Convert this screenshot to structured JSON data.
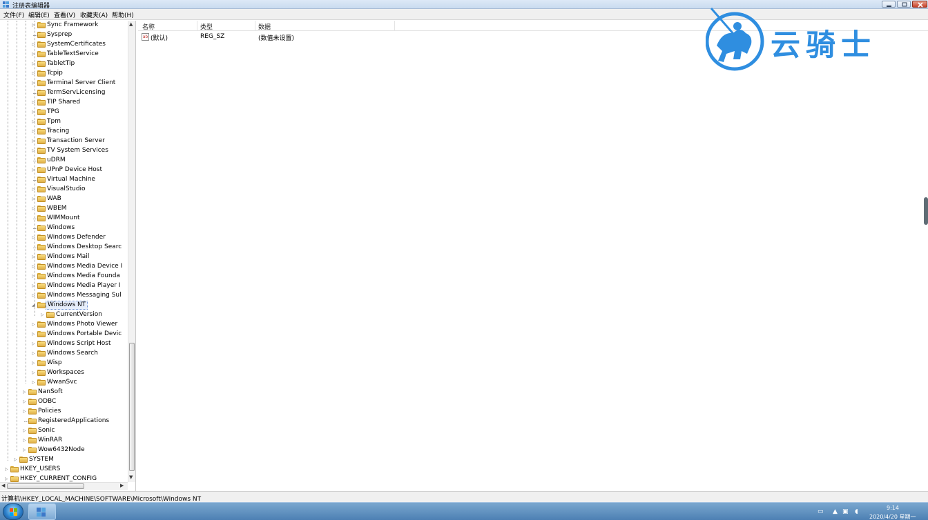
{
  "window": {
    "title": "注册表编辑器"
  },
  "menu": [
    "文件(F)",
    "编辑(E)",
    "查看(V)",
    "收藏夹(A)",
    "帮助(H)"
  ],
  "tree": {
    "items": [
      {
        "label": "Sync Framework",
        "level": 3,
        "expandable": true
      },
      {
        "label": "Sysprep",
        "level": 3,
        "expandable": false
      },
      {
        "label": "SystemCertificates",
        "level": 3,
        "expandable": true
      },
      {
        "label": "TableTextService",
        "level": 3,
        "expandable": true
      },
      {
        "label": "TabletTip",
        "level": 3,
        "expandable": true
      },
      {
        "label": "Tcpip",
        "level": 3,
        "expandable": true
      },
      {
        "label": "Terminal Server Client",
        "level": 3,
        "expandable": true
      },
      {
        "label": "TermServLicensing",
        "level": 3,
        "expandable": false
      },
      {
        "label": "TIP Shared",
        "level": 3,
        "expandable": true
      },
      {
        "label": "TPG",
        "level": 3,
        "expandable": true
      },
      {
        "label": "Tpm",
        "level": 3,
        "expandable": true
      },
      {
        "label": "Tracing",
        "level": 3,
        "expandable": true
      },
      {
        "label": "Transaction Server",
        "level": 3,
        "expandable": true
      },
      {
        "label": "TV System Services",
        "level": 3,
        "expandable": true
      },
      {
        "label": "uDRM",
        "level": 3,
        "expandable": false
      },
      {
        "label": "UPnP Device Host",
        "level": 3,
        "expandable": true
      },
      {
        "label": "Virtual Machine",
        "level": 3,
        "expandable": false
      },
      {
        "label": "VisualStudio",
        "level": 3,
        "expandable": true
      },
      {
        "label": "WAB",
        "level": 3,
        "expandable": true
      },
      {
        "label": "WBEM",
        "level": 3,
        "expandable": true
      },
      {
        "label": "WIMMount",
        "level": 3,
        "expandable": false
      },
      {
        "label": "Windows",
        "level": 3,
        "expandable": false
      },
      {
        "label": "Windows Defender",
        "level": 3,
        "expandable": true
      },
      {
        "label": "Windows Desktop Searc",
        "level": 3,
        "expandable": false
      },
      {
        "label": "Windows Mail",
        "level": 3,
        "expandable": true
      },
      {
        "label": "Windows Media Device I",
        "level": 3,
        "expandable": true
      },
      {
        "label": "Windows Media Founda",
        "level": 3,
        "expandable": true
      },
      {
        "label": "Windows Media Player I",
        "level": 3,
        "expandable": true
      },
      {
        "label": "Windows Messaging Sul",
        "level": 3,
        "expandable": true
      },
      {
        "label": "Windows NT",
        "level": 3,
        "expandable": true,
        "expanded": true,
        "selected": true
      },
      {
        "label": "CurrentVersion",
        "level": 4,
        "expandable": true
      },
      {
        "label": "Windows Photo Viewer",
        "level": 3,
        "expandable": true
      },
      {
        "label": "Windows Portable Devic",
        "level": 3,
        "expandable": true
      },
      {
        "label": "Windows Script Host",
        "level": 3,
        "expandable": true
      },
      {
        "label": "Windows Search",
        "level": 3,
        "expandable": true
      },
      {
        "label": "Wisp",
        "level": 3,
        "expandable": true
      },
      {
        "label": "Workspaces",
        "level": 3,
        "expandable": true
      },
      {
        "label": "WwanSvc",
        "level": 3,
        "expandable": true
      },
      {
        "label": "NanSoft",
        "level": 2,
        "expandable": true
      },
      {
        "label": "ODBC",
        "level": 2,
        "expandable": true
      },
      {
        "label": "Policies",
        "level": 2,
        "expandable": true
      },
      {
        "label": "RegisteredApplications",
        "level": 2,
        "expandable": false
      },
      {
        "label": "Sonic",
        "level": 2,
        "expandable": true
      },
      {
        "label": "WinRAR",
        "level": 2,
        "expandable": true
      },
      {
        "label": "Wow6432Node",
        "level": 2,
        "expandable": true
      },
      {
        "label": "SYSTEM",
        "level": 1,
        "expandable": true
      },
      {
        "label": "HKEY_USERS",
        "level": 0,
        "expandable": true
      },
      {
        "label": "HKEY_CURRENT_CONFIG",
        "level": 0,
        "expandable": true
      }
    ]
  },
  "list": {
    "columns": [
      "名称",
      "类型",
      "数据"
    ],
    "rows": [
      {
        "name": "(默认)",
        "type": "REG_SZ",
        "data": "(数值未设置)"
      }
    ]
  },
  "status": {
    "path": "计算机\\HKEY_LOCAL_MACHINE\\SOFTWARE\\Microsoft\\Windows NT"
  },
  "watermark": {
    "text": "云骑士"
  },
  "taskbar": {
    "time": "9:14",
    "date": "2020/4/20 星期一"
  }
}
